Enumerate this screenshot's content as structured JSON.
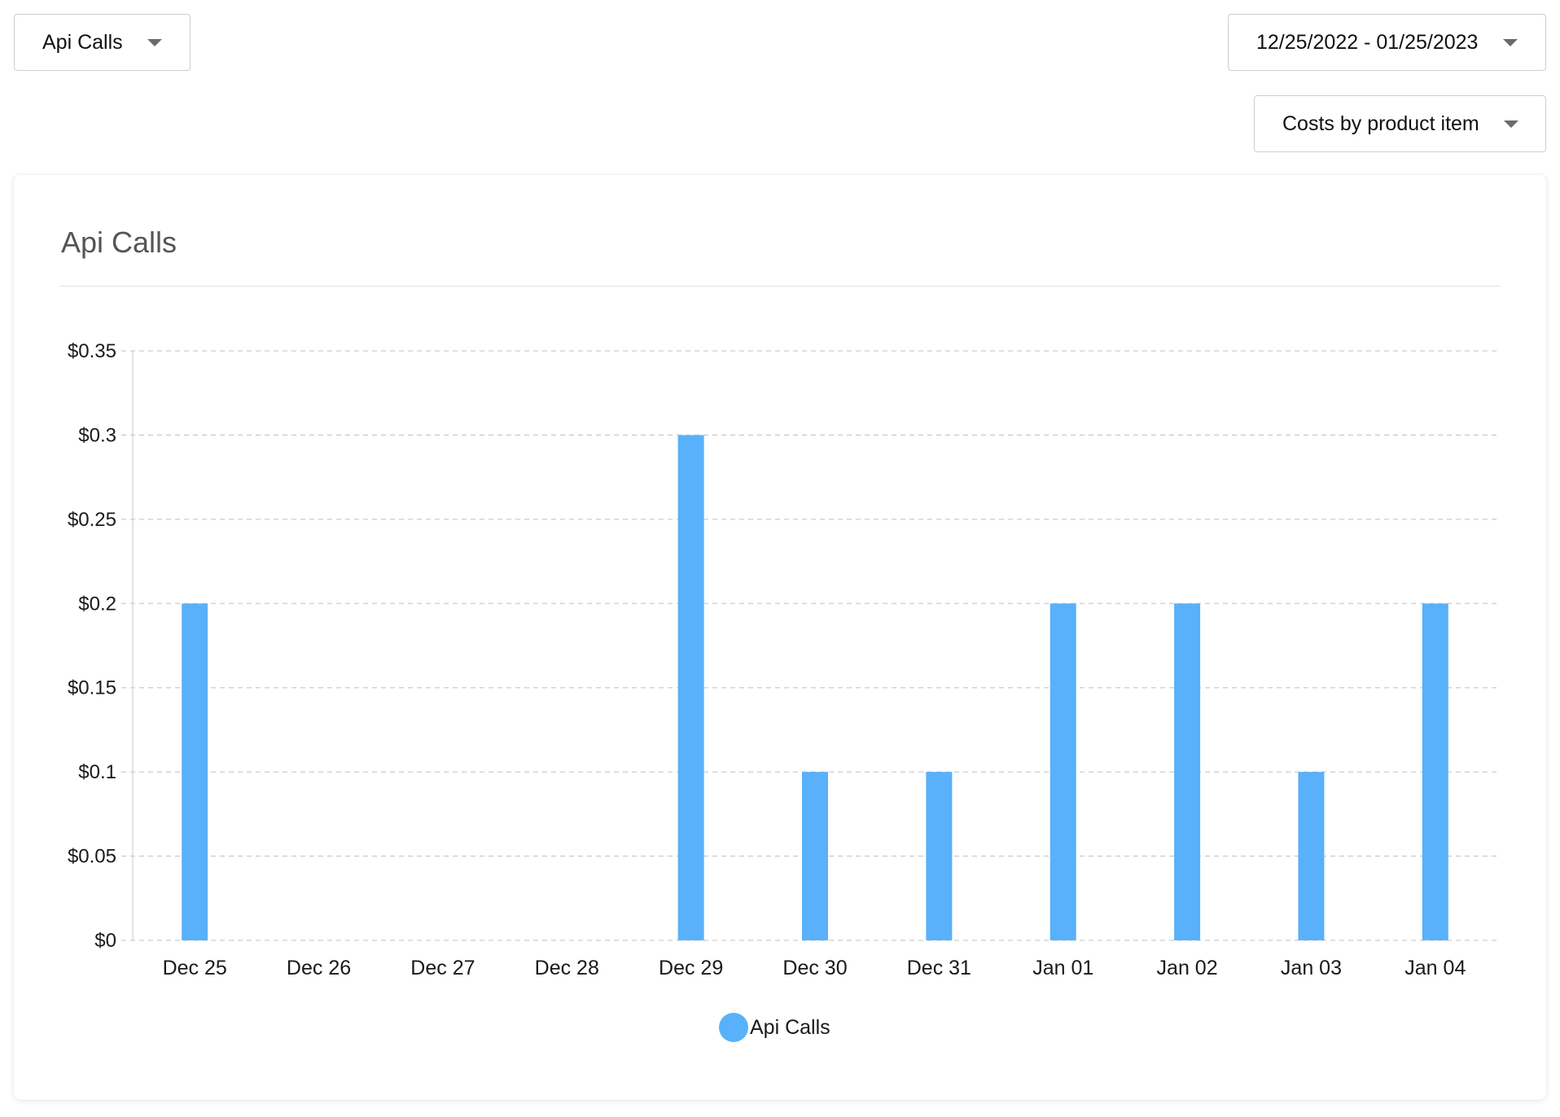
{
  "filters": {
    "product": {
      "value": "Api Calls"
    },
    "date_range": {
      "value": "12/25/2022 - 01/25/2023"
    },
    "group_by": {
      "value": "Costs by product item"
    }
  },
  "card": {
    "title": "Api Calls"
  },
  "colors": {
    "bar": "#58b1fa",
    "grid": "#cccccc",
    "axis": "#d4d4d4"
  },
  "chart_data": {
    "type": "bar",
    "title": "Api Calls",
    "xlabel": "",
    "ylabel": "",
    "categories": [
      "Dec 25",
      "Dec 26",
      "Dec 27",
      "Dec 28",
      "Dec 29",
      "Dec 30",
      "Dec 31",
      "Jan 01",
      "Jan 02",
      "Jan 03",
      "Jan 04"
    ],
    "series": [
      {
        "name": "Api Calls",
        "values": [
          0.2,
          0,
          0,
          0,
          0.3,
          0.1,
          0.1,
          0.2,
          0.2,
          0.1,
          0.2
        ]
      }
    ],
    "ylim": [
      0,
      0.35
    ],
    "yticks": [
      0,
      0.05,
      0.1,
      0.15,
      0.2,
      0.25,
      0.3,
      0.35
    ],
    "ytick_labels": [
      "$0",
      "$0.05",
      "$0.1",
      "$0.15",
      "$0.2",
      "$0.25",
      "$0.3",
      "$0.35"
    ],
    "grid": true,
    "legend": "bottom-center"
  }
}
